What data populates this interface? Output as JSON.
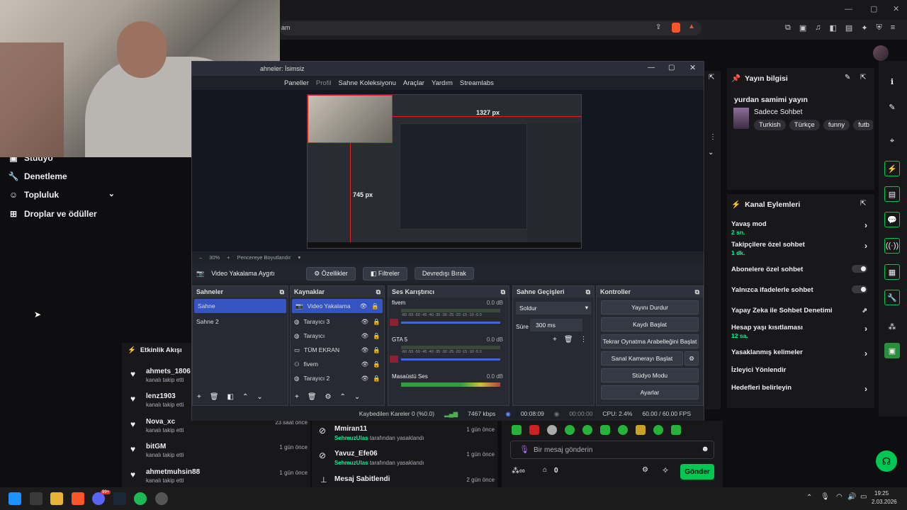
{
  "browser": {
    "address_text": "am"
  },
  "left_nav": {
    "items": [
      {
        "label": "Stüdyo",
        "icon": "studio-icon"
      },
      {
        "label": "Denetleme",
        "icon": "wrench-icon"
      },
      {
        "label": "Topluluk",
        "icon": "community-icon"
      },
      {
        "label": "Droplar ve ödüller",
        "icon": "drops-icon"
      }
    ]
  },
  "obs": {
    "title": "ahneler: İsimsiz",
    "menu": [
      "Paneller",
      "Profil",
      "Sahne Koleksiyonu",
      "Araçlar",
      "Yardım",
      "Streamlabs"
    ],
    "preview_width_label": "1327 px",
    "preview_height_label": "745 px",
    "zoom_label": "30%",
    "fit_label": "Pencereye Boyutlandır",
    "source_label": "Video Yakalama Aygıtı",
    "properties_button": "Özellikler",
    "filters_button": "Filtreler",
    "disable_button": "Devredışı Bırak",
    "scenes_header": "Sahneler",
    "scenes": [
      "Sahne",
      "Sahne 2"
    ],
    "sources_header": "Kaynaklar",
    "sources": [
      "Video Yakalama",
      "Tarayıcı 3",
      "Tarayıcı",
      "TÜM EKRAN",
      "fivem",
      "Tarayıcı 2"
    ],
    "mixer_header": "Ses Karıştırıcı",
    "mixer": [
      {
        "name": "fivem",
        "db": "0.0 dB"
      },
      {
        "name": "GTA 5",
        "db": "0.0 dB"
      },
      {
        "name": "Masaüstü Ses",
        "db": "0.0 dB"
      }
    ],
    "mixer_scale": "-60 -55 -50 -45 -40 -35 -30 -25 -20 -15 -10 -5 0",
    "transitions_header": "Sahne Geçişleri",
    "transition": "Soldur",
    "duration_label": "Süre",
    "duration_value": "300 ms",
    "controls_header": "Kontroller",
    "controls": [
      "Yayını Durdur",
      "Kaydı Başlat",
      "Tekrar Oynatma Arabelleğini Başlat",
      "Sanal Kamerayı Başlat",
      "Stüdyo Modu",
      "Ayarlar"
    ],
    "status": {
      "dropped": "Kaybedilen Kareler 0 (%0.0)",
      "bitrate": "7467 kbps",
      "live_time": "00:08:09",
      "rec_time": "00:00:00",
      "cpu": "CPU: 2.4%",
      "fps": "60.00 / 60.00 FPS"
    }
  },
  "stream_info": {
    "header": "Yayın bilgisi",
    "title": "yurdan samimi yayın",
    "category": "Sadece Sohbet",
    "tags": [
      "Turkish",
      "Türkçe",
      "funny",
      "futb"
    ]
  },
  "channel_actions": {
    "header": "Kanal Eylemleri",
    "items": [
      {
        "label": "Yavaş mod",
        "sub": "2 sn.",
        "control": "chevron"
      },
      {
        "label": "Takipçilere özel sohbet",
        "sub": "1 dk.",
        "control": "chevron"
      },
      {
        "label": "Abonelere özel sohbet",
        "sub": "",
        "control": "toggle"
      },
      {
        "label": "Yalnızca ifadelerle sohbet",
        "sub": "",
        "control": "toggle"
      },
      {
        "label": "Yapay Zeka ile Sohbet Denetimi",
        "sub": "",
        "control": "external"
      },
      {
        "label": "Hesap yaşı kısıtlaması",
        "sub": "12 sa.",
        "control": "chevron"
      },
      {
        "label": "Yasaklanmış kelimeler",
        "sub": "",
        "control": "chevron"
      },
      {
        "label": "İzleyici Yönlendir",
        "sub": "",
        "control": "none"
      },
      {
        "label": "Hedefleri belirleyin",
        "sub": "",
        "control": "chevron"
      }
    ]
  },
  "activity": {
    "header": "Etkinlik Akışı",
    "items": [
      {
        "name": "ahmets_1806",
        "desc": "kanalı takip etti",
        "time": ""
      },
      {
        "name": "lenz1903",
        "desc": "kanalı takip etti",
        "time": ""
      },
      {
        "name": "Nova_xc",
        "desc": "kanalı takip etti",
        "time": "23 saat önce"
      },
      {
        "name": "bitGM",
        "desc": "kanalı takip etti",
        "time": "1 gün önce"
      },
      {
        "name": "ahmetmuhsin88",
        "desc": "kanalı takip etti",
        "time": "1 gün önce"
      }
    ]
  },
  "modlog": {
    "items": [
      {
        "name": "Mmiran11",
        "by": "SehmuzUlas",
        "desc": "tarafından yasaklandı",
        "time": "1 gün önce"
      },
      {
        "name": "Yavuz_Efe06",
        "by": "SehmuzUlas",
        "desc": "tarafından yasaklandı",
        "time": "1 gün önce"
      },
      {
        "name": "Mesaj Sabitlendi",
        "by": "",
        "desc": "",
        "time": "2 gün önce"
      }
    ]
  },
  "chat": {
    "placeholder": "Bir mesaj gönderin",
    "points": "0",
    "send_label": "Gönder"
  },
  "taskbar": {
    "time": "19:25",
    "date": "2.03.2026",
    "badge": "99+"
  }
}
